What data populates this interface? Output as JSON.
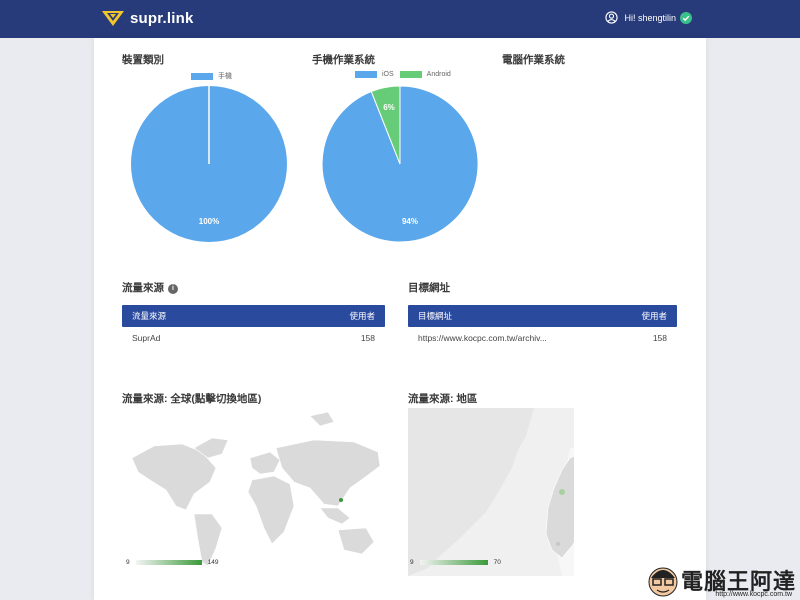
{
  "header": {
    "brand": "supr.link",
    "greeting": "Hi! shengtilin"
  },
  "sections": {
    "device_type": {
      "title": "裝置類別",
      "legend": [
        "手機"
      ],
      "slice_labels": [
        "100%"
      ]
    },
    "mobile_os": {
      "title": "手機作業系統",
      "legend": [
        "iOS",
        "Android"
      ],
      "slice_labels": [
        "94%",
        "6%"
      ]
    },
    "desktop_os": {
      "title": "電腦作業系統"
    }
  },
  "traffic_source": {
    "title": "流量來源",
    "col_source": "流量來源",
    "col_users": "使用者",
    "rows": [
      {
        "source": "SuprAd",
        "users": "158"
      }
    ]
  },
  "target_url": {
    "title": "目標網址",
    "col_url": "目標網址",
    "col_users": "使用者",
    "rows": [
      {
        "url": "https://www.kocpc.com.tw/archiv...",
        "users": "158"
      }
    ]
  },
  "world_map": {
    "title": "流量來源: 全球(點擊切換地區)",
    "min": "9",
    "max": "149"
  },
  "region_map": {
    "title": "流量來源: 地區",
    "min": "9",
    "max": "70"
  },
  "watermark": {
    "title": "電腦王阿達",
    "url": "http://www.kocpc.com.tw"
  },
  "colors": {
    "ios": "#5aa7ec",
    "android": "#66cc77",
    "header": "#273b7a",
    "table_header": "#2a4a9e"
  },
  "chart_data": [
    {
      "type": "pie",
      "title": "裝置類別",
      "categories": [
        "手機"
      ],
      "values": [
        100
      ],
      "legend_position": "top"
    },
    {
      "type": "pie",
      "title": "手機作業系統",
      "categories": [
        "iOS",
        "Android"
      ],
      "values": [
        94,
        6
      ],
      "legend_position": "top"
    }
  ]
}
